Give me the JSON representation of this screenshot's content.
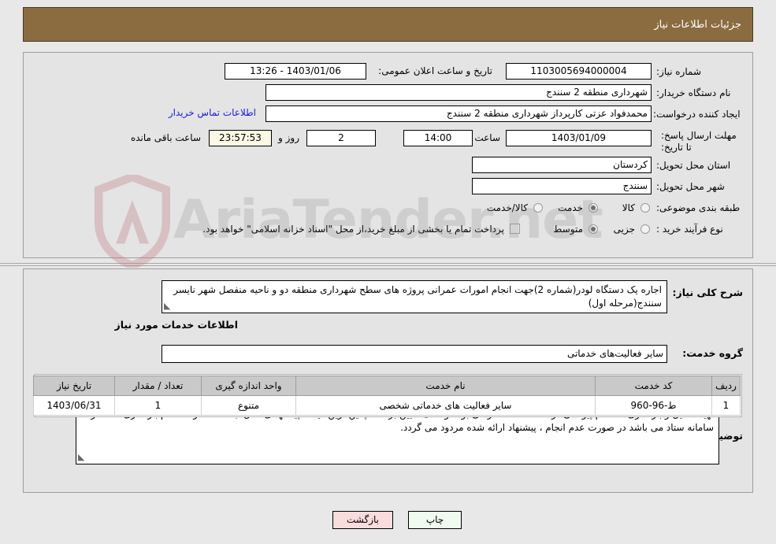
{
  "header": {
    "title": "جزئیات اطلاعات نیاز"
  },
  "top_form": {
    "need_number_label": "شماره نیاز:",
    "need_number_value": "1103005694000004",
    "announce_datetime_label": "تاریخ و ساعت اعلان عمومی:",
    "announce_datetime_value": "1403/01/06 - 13:26",
    "buyer_org_label": "نام دستگاه خریدار:",
    "buyer_org_value": "شهرداری منطقه 2 سنندج",
    "requester_label": "ایجاد کننده درخواست:",
    "requester_value": "محمدفواد عزتی کارپرداز شهرداری منطقه 2 سنندج",
    "contact_link": "اطلاعات تماس خریدار",
    "deadline_label": "مهلت ارسال پاسخ: تا تاریخ:",
    "deadline_date": "1403/01/09",
    "hour_label": "ساعت",
    "deadline_hour": "14:00",
    "days_value": "2",
    "days_label": "روز و",
    "countdown_value": "23:57:53",
    "remaining_label": "ساعت باقی مانده",
    "province_label": "استان محل تحویل:",
    "province_value": "کردستان",
    "city_label": "شهر محل تحویل:",
    "city_value": "سنندج",
    "category_label": "طبقه بندی موضوعی:",
    "category_options": [
      {
        "label": "کالا",
        "selected": false
      },
      {
        "label": "خدمت",
        "selected": true
      },
      {
        "label": "کالا/خدمت",
        "selected": false
      }
    ],
    "process_label": "نوع فرآیند خرید :",
    "process_options": [
      {
        "label": "جزیی",
        "selected": false
      },
      {
        "label": "متوسط",
        "selected": true
      }
    ],
    "treasury_checkbox_checked": false,
    "treasury_text": "پرداخت تمام یا بخشی از مبلغ خرید،از محل \"اسناد خزانه اسلامی\" خواهد بود."
  },
  "mid_form": {
    "need_desc_label": "شرح کلی نیاز:",
    "need_desc_value": "اجاره یک دستگاه لودر(شماره 2)جهت انجام امورات عمرانی پروژه های سطح شهرداری منطقه دو و ناحیه منفصل شهر نایسر سنندج(مرحله اول)",
    "services_section_title": "اطلاعات خدمات مورد نیاز",
    "service_group_label": "گروه خدمت:",
    "service_group_value": "سایر فعالیت‌های خدماتی",
    "buyer_notes_label": "توضیحات خریدار:",
    "buyer_notes_value": "تهیه  تکمیل و بارگذاری استعلام پیوستی در سامانه ستاد الزامی بوده و ملاک تعیین برنده ، پائین ترین قیمت پیشنهادی ، کل ثبت شده در استعلام بارگذاری شده در سامانه ستاد می باشد در صورت عدم انجام ، پیشنهاد ارائه شده مردود می گردد."
  },
  "table": {
    "columns": [
      "ردیف",
      "کد خدمت",
      "نام خدمت",
      "واحد اندازه گیری",
      "تعداد / مقدار",
      "تاریخ نیاز"
    ],
    "rows": [
      {
        "row_no": "1",
        "service_code": "ط-96-960",
        "service_name": "سایر فعالیت های خدماتی شخصی",
        "unit": "متنوع",
        "quantity": "1",
        "need_date": "1403/06/31"
      }
    ]
  },
  "footer": {
    "print_label": "چاپ",
    "back_label": "بازگشت"
  },
  "watermark": {
    "text": "AriaTender.net"
  },
  "colors": {
    "header_bar": "#8b6c40",
    "page_bg": "#e8e8e8",
    "panel_bg": "#e4e4e4",
    "link": "#1a1ae0",
    "countdown_bg": "#fbf8e3",
    "print_btn_bg": "#eefbee",
    "back_btn_bg": "#fbdcdc",
    "table_header_bg": "#c9c9c9"
  }
}
